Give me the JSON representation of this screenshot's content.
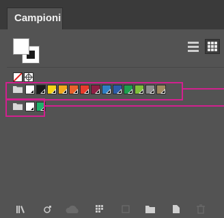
{
  "panel": {
    "tab_label": "Campioni"
  },
  "colors": {
    "panel_bg": "#535353",
    "highlight": "#d3208f"
  },
  "toolbar": {
    "fill_stroke": "fill-stroke-icon",
    "view_buttons": [
      "list-view-icon",
      "grid-view-icon"
    ]
  },
  "swatches": {
    "row1": [
      "none-swatch",
      "registration-swatch"
    ],
    "row2": [
      "#ffffff",
      "#1a1a1a",
      "#f7d417",
      "#f2a91c",
      "#e8612a",
      "#e83b2c",
      "#8f1f45",
      "#2f7fc4",
      "#2c5ba8",
      "#1d9f4d",
      "#7fbf3a",
      "#8d8d8d",
      "#a08a60"
    ],
    "group_row": [
      "#ffffff",
      "#1db36b"
    ]
  },
  "bottom_icons": [
    "swatch-libraries-icon",
    "place-swatch-icon",
    "cloud-icon",
    "swatch-options-icon",
    "color-group-icon",
    "new-folder-icon",
    "new-swatch-icon",
    "delete-icon"
  ]
}
